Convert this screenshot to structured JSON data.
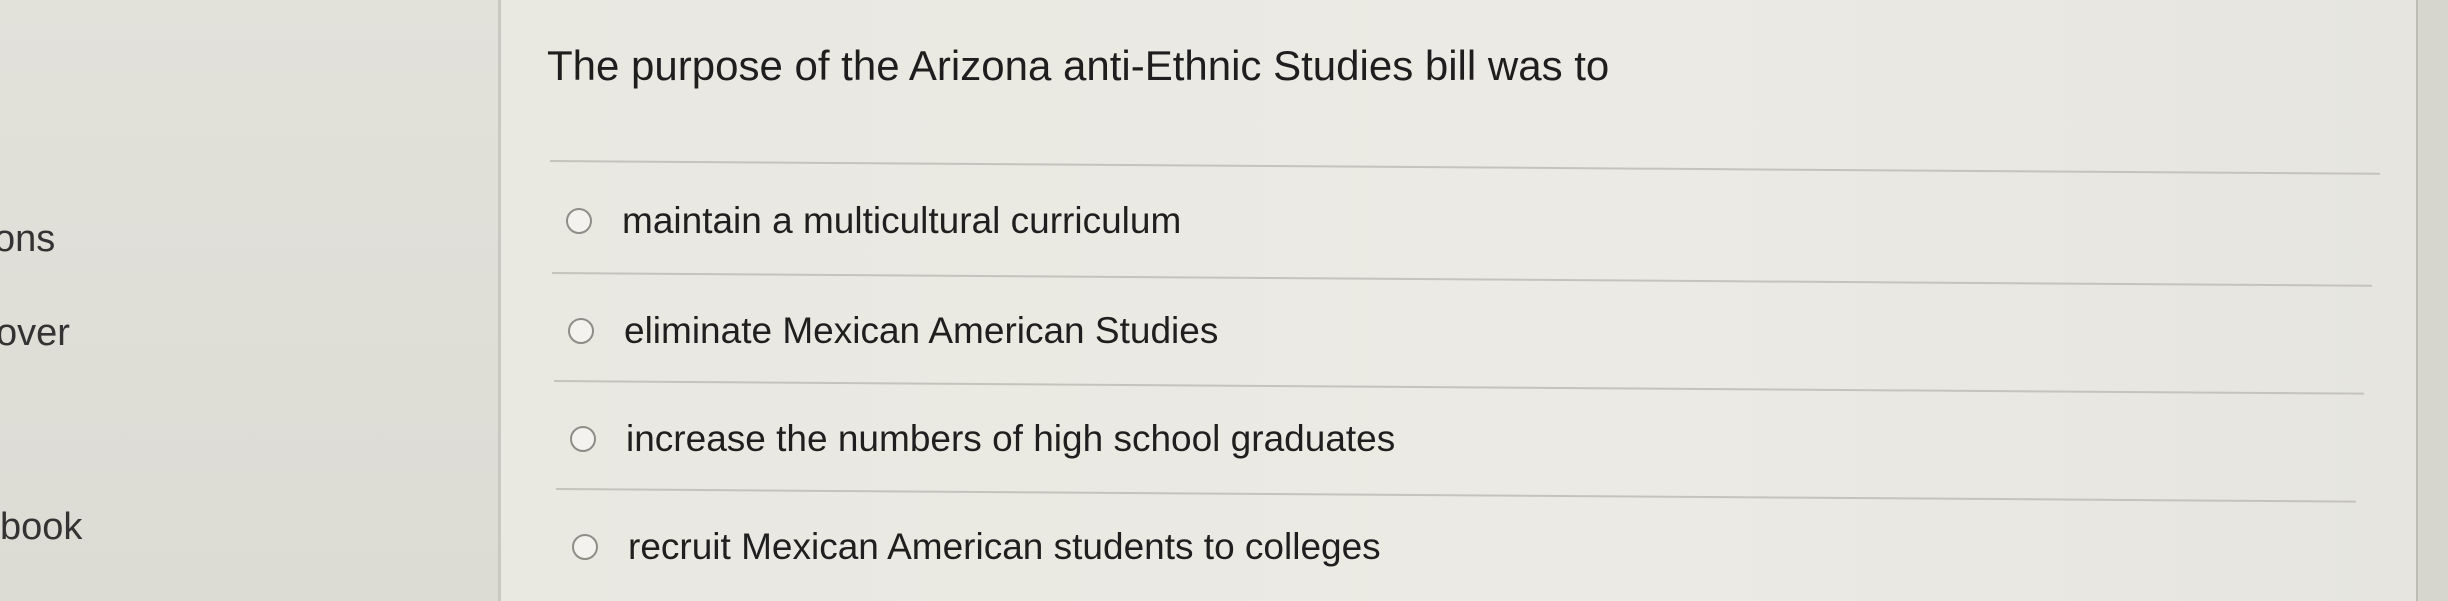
{
  "sidebar": {
    "items": [
      {
        "label": "ons"
      },
      {
        "label": "over"
      },
      {
        "label": "book"
      }
    ]
  },
  "question": {
    "text": "The purpose of the Arizona anti-Ethnic Studies bill was to",
    "options": [
      {
        "label": "maintain a multicultural curriculum"
      },
      {
        "label": "eliminate Mexican American Studies"
      },
      {
        "label": "increase the numbers of high school graduates"
      },
      {
        "label": "recruit Mexican American students to colleges"
      }
    ]
  }
}
